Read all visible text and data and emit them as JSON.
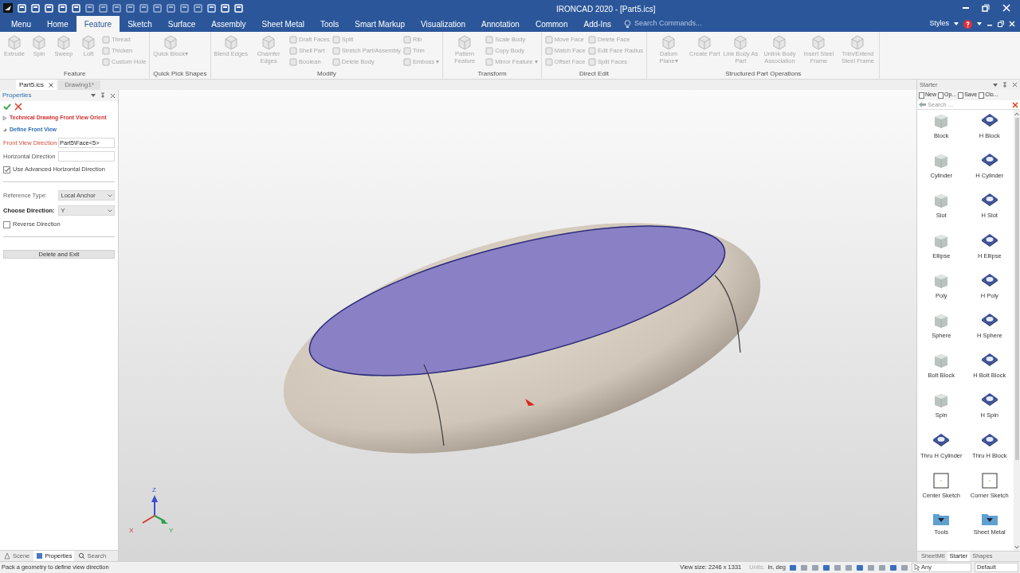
{
  "window": {
    "title": "IRONCAD 2020 - [Part5.ics]"
  },
  "ribbon_tabs": [
    {
      "label": "Menu",
      "selected": false
    },
    {
      "label": "Home",
      "selected": false
    },
    {
      "label": "Feature",
      "selected": true
    },
    {
      "label": "Sketch",
      "selected": false
    },
    {
      "label": "Surface",
      "selected": false
    },
    {
      "label": "Assembly",
      "selected": false
    },
    {
      "label": "Sheet Metal",
      "selected": false
    },
    {
      "label": "Tools",
      "selected": false
    },
    {
      "label": "Smart Markup",
      "selected": false
    },
    {
      "label": "Visualization",
      "selected": false
    },
    {
      "label": "Annotation",
      "selected": false
    },
    {
      "label": "Common",
      "selected": false
    },
    {
      "label": "Add-Ins",
      "selected": false
    }
  ],
  "command_search": {
    "placeholder": "Search Commands..."
  },
  "top_right": {
    "styles": "Styles"
  },
  "ribbon": {
    "groups": [
      {
        "label": "Feature",
        "items": [
          {
            "kind": "large",
            "label": "Extrude"
          },
          {
            "kind": "large",
            "label": "Spin"
          },
          {
            "kind": "large",
            "label": "Sweep"
          },
          {
            "kind": "large",
            "label": "Loft"
          },
          {
            "kind": "small",
            "label": "Thread"
          },
          {
            "kind": "small",
            "label": "Thicken"
          },
          {
            "kind": "small",
            "label": "Custom Hole"
          }
        ]
      },
      {
        "label": "Quick Pick Shapes",
        "items": [
          {
            "kind": "large",
            "label": "Quick Block▾"
          }
        ]
      },
      {
        "label": "Modify",
        "items": [
          {
            "kind": "large",
            "label": "Blend Edges"
          },
          {
            "kind": "large",
            "label": "Chamfer Edges"
          },
          {
            "kind": "small",
            "label": "Draft Faces"
          },
          {
            "kind": "small",
            "label": "Shell Part"
          },
          {
            "kind": "small",
            "label": "Boolean"
          },
          {
            "kind": "small",
            "label": "Split"
          },
          {
            "kind": "small",
            "label": "Stretch Part/Assembly"
          },
          {
            "kind": "small",
            "label": "Delete Body"
          },
          {
            "kind": "small",
            "label": "Rib"
          },
          {
            "kind": "small",
            "label": "Trim"
          },
          {
            "kind": "small",
            "label": "Emboss ▾"
          }
        ]
      },
      {
        "label": "Transform",
        "items": [
          {
            "kind": "large",
            "label": "Pattern Feature"
          },
          {
            "kind": "small",
            "label": "Scale Body"
          },
          {
            "kind": "small",
            "label": "Copy Body"
          },
          {
            "kind": "small",
            "label": "Mirror Feature ▾"
          }
        ]
      },
      {
        "label": "Direct Edit",
        "items": [
          {
            "kind": "small",
            "label": "Move Face"
          },
          {
            "kind": "small",
            "label": "Match Face"
          },
          {
            "kind": "small",
            "label": "Offset Face"
          },
          {
            "kind": "small",
            "label": "Delete Face"
          },
          {
            "kind": "small",
            "label": "Edit Face Radius"
          },
          {
            "kind": "small",
            "label": "Split Faces"
          }
        ]
      },
      {
        "label": "Structured Part Operations",
        "items": [
          {
            "kind": "large",
            "label": "Datum Plane▾"
          },
          {
            "kind": "large",
            "label": "Create Part"
          },
          {
            "kind": "large",
            "label": "Link Body As Part"
          },
          {
            "kind": "large",
            "label": "Unlink Body Association"
          },
          {
            "kind": "large",
            "label": "Insert Steel Frame"
          },
          {
            "kind": "large",
            "label": "Trim/Extend Steel Frame"
          }
        ]
      }
    ]
  },
  "document_tabs": [
    {
      "label": "Part5.ics",
      "selected": true
    },
    {
      "label": "Drawing1*",
      "selected": false
    }
  ],
  "properties": {
    "title": "Properties",
    "sections": [
      {
        "label": "Technical Drawing Front View Orient",
        "expanded": false
      },
      {
        "label": "Define Front View",
        "expanded": true
      }
    ],
    "rows": [
      {
        "kind": "text",
        "label": "Front View Direction",
        "highlight": true,
        "value": "Part5\\Face<5>"
      },
      {
        "kind": "text",
        "label": "Horizontal Direction",
        "highlight": false
      },
      {
        "kind": "checkbox",
        "label": "Use Advanced Horizontal Direction",
        "checked": true
      },
      {
        "kind": "divider"
      },
      {
        "kind": "select",
        "label": "Reference Type:",
        "bold": false,
        "value": "Local Anchor"
      },
      {
        "kind": "select",
        "label": "Choose Direction:",
        "bold": true,
        "value": "Y"
      },
      {
        "kind": "checkbox",
        "label": "Reverse Direction",
        "checked": false
      },
      {
        "kind": "divider"
      },
      {
        "kind": "button",
        "label": "Delete and Exit"
      }
    ]
  },
  "left_bottom_tabs": [
    {
      "label": "Scene",
      "selected": false
    },
    {
      "label": "Properties",
      "selected": true
    },
    {
      "label": "Search",
      "selected": false
    }
  ],
  "viewport": {
    "triad": {
      "z": "Z",
      "x": "X",
      "y": "Y"
    }
  },
  "catalog": {
    "title": "Starter",
    "toolbar": [
      "New",
      "Op...",
      "Save",
      "Clo..."
    ],
    "search": {
      "placeholder": "Search ..."
    },
    "items": [
      {
        "kind": "solid",
        "label": "Block"
      },
      {
        "kind": "hollow",
        "label": "H Block"
      },
      {
        "kind": "solid",
        "label": "Cylinder"
      },
      {
        "kind": "hollow",
        "label": "H Cylinder"
      },
      {
        "kind": "solid",
        "label": "Slot"
      },
      {
        "kind": "hollow",
        "label": "H Slot"
      },
      {
        "kind": "solid",
        "label": "Ellipse"
      },
      {
        "kind": "hollow",
        "label": "H Ellipse"
      },
      {
        "kind": "solid",
        "label": "Poly"
      },
      {
        "kind": "hollow",
        "label": "H Poly"
      },
      {
        "kind": "solid",
        "label": "Sphere"
      },
      {
        "kind": "hollow",
        "label": "H Sphere"
      },
      {
        "kind": "solid",
        "label": "Bolt Block"
      },
      {
        "kind": "hollow",
        "label": "H Bolt Block"
      },
      {
        "kind": "solid",
        "label": "Spin"
      },
      {
        "kind": "hollow",
        "label": "H Spin"
      },
      {
        "kind": "hollow",
        "label": "Thru H Cylinder"
      },
      {
        "kind": "hollow",
        "label": "Thru H Block"
      },
      {
        "kind": "sketch",
        "label": "Center Sketch"
      },
      {
        "kind": "sketch",
        "label": "Corner Sketch"
      },
      {
        "kind": "folder",
        "label": "Tools"
      },
      {
        "kind": "folder",
        "label": "Sheet Metal"
      }
    ],
    "bottom_tabs": [
      {
        "label": "SheetMtl",
        "selected": false
      },
      {
        "label": "Starter",
        "selected": true
      },
      {
        "label": "Shapes",
        "selected": false
      }
    ]
  },
  "status_bar": {
    "message": "Pack a geometry to define view direction",
    "view_size": "View size: 2246 x 1331",
    "units_label": "Units:",
    "units": "in, deg",
    "filter": "Any",
    "style": "Default"
  }
}
